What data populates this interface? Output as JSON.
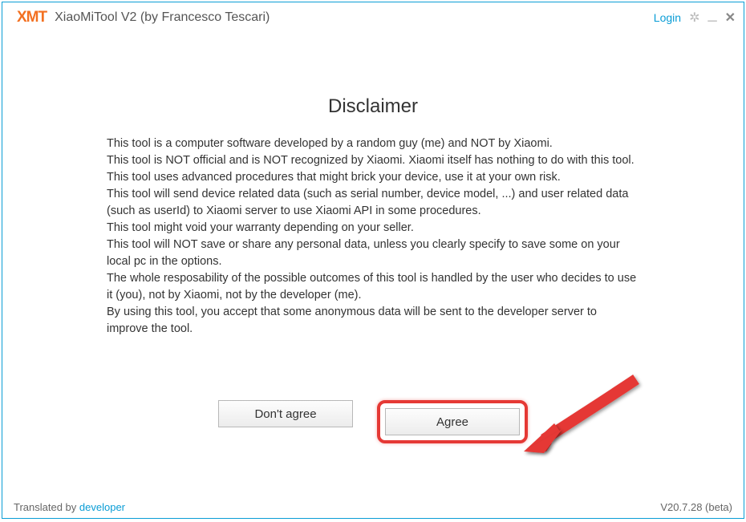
{
  "titlebar": {
    "logo": "XMT",
    "title": "XiaoMiTool V2 (by Francesco Tescari)",
    "login": "Login"
  },
  "disclaimer": {
    "heading": "Disclaimer",
    "p1": "This tool is a computer software developed by a random guy (me) and NOT by Xiaomi.",
    "p2": "This tool is NOT official and is NOT recognized by Xiaomi. Xiaomi itself has nothing to do with this tool.",
    "p3": "This tool uses advanced procedures that might brick your device, use it at your own risk.",
    "p4": "This tool will send device related data (such as serial number, device model, ...) and user related data (such as userId) to Xiaomi server to use Xiaomi API in some procedures.",
    "p5": "This tool might void your warranty depending on your seller.",
    "p6": "This tool will NOT save or share any personal data, unless you clearly specify to save some on your local pc in the options.",
    "p7": "The whole resposability of the possible outcomes of this tool is handled by the user who decides to use it (you), not by Xiaomi, not by the developer (me).",
    "p8": "By using this tool, you accept that some anonymous data will be sent to the developer server to improve the tool."
  },
  "buttons": {
    "dont_agree": "Don't agree",
    "agree": "Agree"
  },
  "footer": {
    "translated_by": "Translated by ",
    "developer": "developer",
    "version": "V20.7.28 (beta)"
  }
}
